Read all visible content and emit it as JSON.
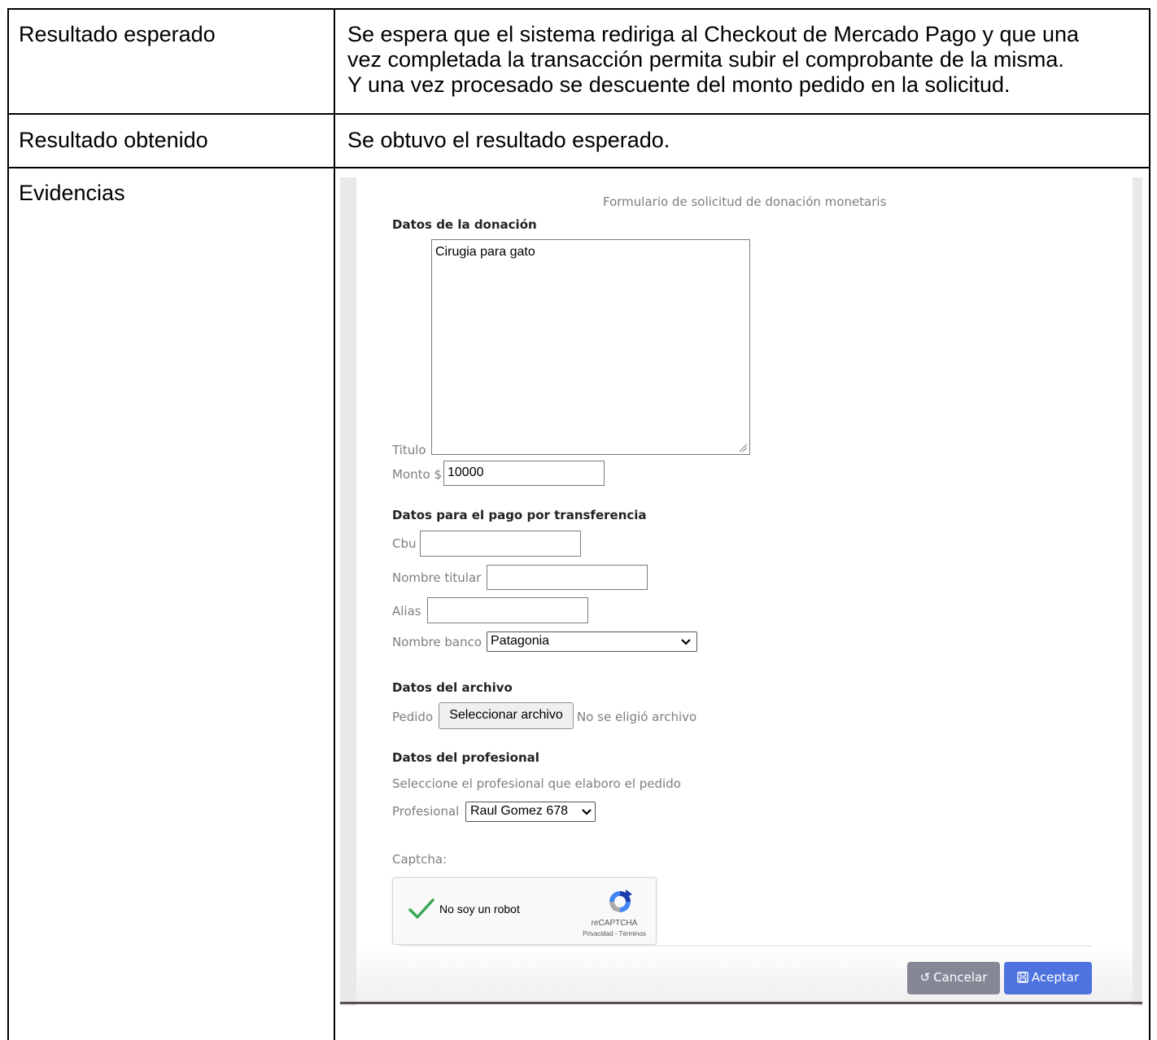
{
  "rows": [
    {
      "label": "Resultado esperado",
      "content_lines": [
        "Se espera que el sistema rediriga al Checkout de Mercado Pago y que una",
        "vez completada la transacción permita subir el comprobante de la misma.",
        "Y una vez procesado se descuente del monto pedido en la solicitud."
      ]
    },
    {
      "label": "Resultado obtenido",
      "content": "Se obtuvo el resultado esperado."
    },
    {
      "label": "Evidencias"
    }
  ],
  "form": {
    "title": "Formulario de solicitud de donación monetaris",
    "section_donacion": "Datos de la donación",
    "titulo_label": "Titulo",
    "titulo_value": "Cirugia para gato",
    "monto_label": "Monto $",
    "monto_value": "10000",
    "section_transferencia": "Datos para el pago por transferencia",
    "cbu_label": "Cbu",
    "cbu_value": "",
    "nombre_titular_label": "Nombre titular",
    "nombre_titular_value": "",
    "alias_label": "Alias",
    "alias_value": "",
    "nombre_banco_label": "Nombre banco",
    "nombre_banco_value": "Patagonia",
    "section_archivo": "Datos del archivo",
    "pedido_label": "Pedido",
    "file_button": "Seleccionar archivo",
    "file_status": "No se eligió archivo",
    "section_profesional": "Datos del profesional",
    "profesional_hint": "Seleccione el profesional que elaboro el pedido",
    "profesional_label": "Profesional",
    "profesional_value": "Raul Gomez 678",
    "captcha_label": "Captcha:",
    "captcha_text": "No soy un robot",
    "captcha_brand": "reCAPTCHA",
    "captcha_terms": "Privacidad - Términos",
    "cancel_button": "Cancelar",
    "accept_button": "Aceptar"
  },
  "icons": {
    "cancel": "undo-icon",
    "accept": "save-icon",
    "captcha_check": "checkmark-icon",
    "captcha_logo": "recaptcha-logo-icon",
    "select": "chevron-down-icon"
  },
  "colors": {
    "cancel_button": "#858796",
    "accept_button": "#4e73df",
    "captcha_check": "#3aa757"
  }
}
